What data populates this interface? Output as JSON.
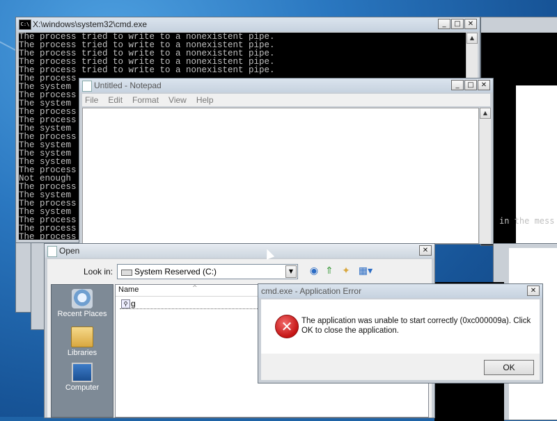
{
  "cmd": {
    "title": "X:\\windows\\system32\\cmd.exe",
    "icon_label": "C:\\",
    "lines": [
      "The process tried to write to a nonexistent pipe.",
      "The process tried to write to a nonexistent pipe.",
      "The process tried to write to a nonexistent pipe.",
      "The process tried to write to a nonexistent pipe.",
      "The process tried to write to a nonexistent pipe.",
      "The process",
      "The system",
      "The process",
      "The system",
      "The process",
      "The process",
      "The system",
      "The process",
      "The system",
      "The system",
      "The system",
      "The process",
      "Not enough",
      "The process",
      "The system",
      "The process",
      "The system",
      "The process",
      "The process",
      "The process"
    ]
  },
  "background_window": {
    "text": "in the mess"
  },
  "notepad": {
    "title": "Untitled - Notepad",
    "menu": [
      "File",
      "Edit",
      "Format",
      "View",
      "Help"
    ]
  },
  "open_dialog": {
    "title": "Open",
    "look_in_label": "Look in:",
    "look_in_value": "System Reserved (C:)",
    "places": [
      "Recent Places",
      "Libraries",
      "Computer"
    ],
    "column_name": "Name",
    "file_name": "g"
  },
  "error_dialog": {
    "title": "cmd.exe - Application Error",
    "message": "The application was unable to start correctly (0xc000009a). Click OK to close the application.",
    "ok_label": "OK"
  },
  "caption_buttons": {
    "minimize": "_",
    "maximize": "□",
    "close": "✕"
  }
}
